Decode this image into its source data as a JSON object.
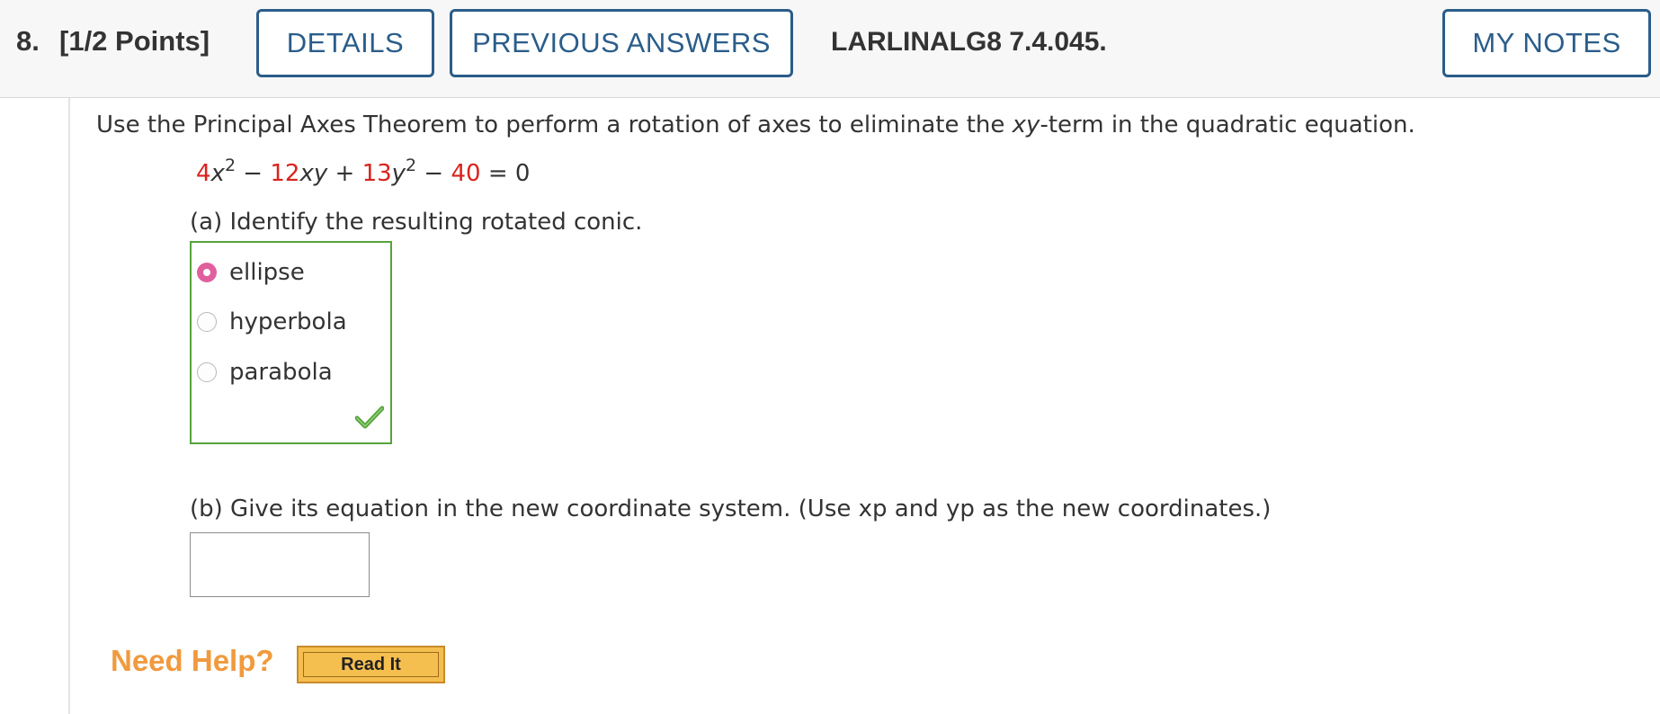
{
  "header": {
    "question_number": "8.",
    "points": "[1/2 Points]",
    "details_label": "DETAILS",
    "previous_answers_label": "PREVIOUS ANSWERS",
    "question_code": "LARLINALG8 7.4.045.",
    "my_notes_label": "MY NOTES"
  },
  "question": {
    "prompt_before": "Use the Principal Axes Theorem to perform a rotation of axes to eliminate the ",
    "prompt_italic": "xy",
    "prompt_after": "-term in the quadratic equation.",
    "equation": {
      "c1": "4",
      "v1": "x",
      "e1": "2",
      "op1": " − ",
      "c2": "12",
      "v2": "xy",
      "op2": " + ",
      "c3": "13",
      "v3": "y",
      "e3": "2",
      "op3": " − ",
      "c4": "40",
      "rhs": " = 0"
    },
    "part_a": {
      "label": "(a) Identify the resulting rotated conic.",
      "options": [
        {
          "label": "ellipse",
          "selected": true
        },
        {
          "label": "hyperbola",
          "selected": false
        },
        {
          "label": "parabola",
          "selected": false
        }
      ],
      "status_icon": "checkmark-icon",
      "status_color": "#57a33c"
    },
    "part_b": {
      "label": "(b) Give its equation in the new coordinate system. (Use xp and yp as the new coordinates.)",
      "input_value": ""
    }
  },
  "help": {
    "need_help_label": "Need Help?",
    "read_it_label": "Read It"
  },
  "colors": {
    "accent": "#2a5d8a",
    "coefficient_red": "#d9231d",
    "correct_green": "#57a33c",
    "radio_selected": "#e0609e",
    "need_help_orange": "#f09a3e"
  }
}
